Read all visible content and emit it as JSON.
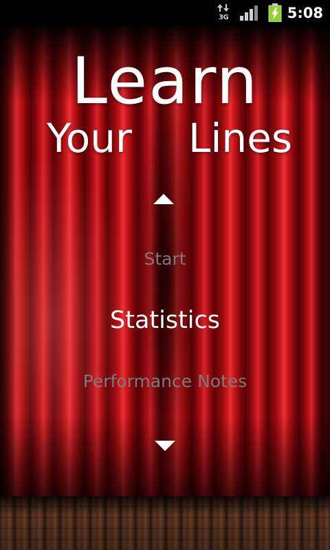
{
  "status_bar": {
    "network_type": "3G",
    "network_icon": "data-arrows-icon",
    "signal_icon": "signal-strength-icon",
    "battery_icon": "battery-charging-icon",
    "time": "5:08"
  },
  "title": {
    "line1": "Learn",
    "line2_word1": "Your",
    "line2_word2": "Lines"
  },
  "menu": {
    "up_icon": "triangle-up-icon",
    "down_icon": "triangle-down-icon",
    "items": [
      {
        "label": "Start",
        "state": "dim"
      },
      {
        "label": "Statistics",
        "state": "selected"
      },
      {
        "label": "Performance Notes",
        "state": "dim"
      }
    ]
  },
  "colors": {
    "curtain_red": "#c8171a",
    "selected_text": "#ffffff",
    "dim_text": "#7d7a7a",
    "battery_green": "#8fd22a"
  }
}
